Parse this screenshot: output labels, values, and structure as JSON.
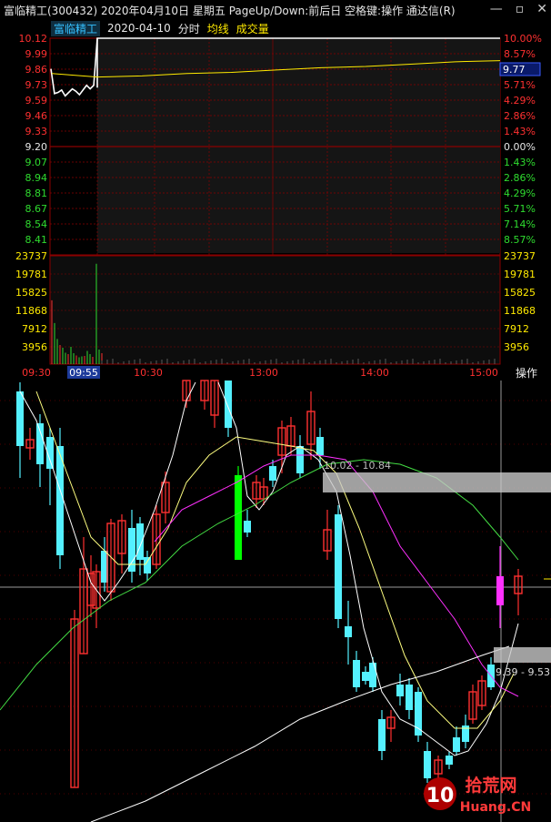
{
  "window": {
    "title": "富临精工(300432)  2020年04月10日  星期五  PageUp/Down:前后日  空格键:操作  通达信(R)",
    "buttons": [
      "—",
      "▫",
      "✕"
    ]
  },
  "subheader": {
    "stock_name": "富临精工",
    "date": "2020-04-10",
    "mode": "分时",
    "avg_label": "均线",
    "volume_label": "成交量"
  },
  "price_axis_left": [
    {
      "v": "10.12",
      "c": "#ff3030"
    },
    {
      "v": "9.99",
      "c": "#ff3030"
    },
    {
      "v": "9.86",
      "c": "#ff3030"
    },
    {
      "v": "9.73",
      "c": "#ff3030"
    },
    {
      "v": "9.59",
      "c": "#ff3030"
    },
    {
      "v": "9.46",
      "c": "#ff3030"
    },
    {
      "v": "9.33",
      "c": "#ff3030"
    },
    {
      "v": "9.20",
      "c": "#e6e6e6"
    },
    {
      "v": "9.07",
      "c": "#2fdc2f"
    },
    {
      "v": "8.94",
      "c": "#2fdc2f"
    },
    {
      "v": "8.81",
      "c": "#2fdc2f"
    },
    {
      "v": "8.67",
      "c": "#2fdc2f"
    },
    {
      "v": "8.54",
      "c": "#2fdc2f"
    },
    {
      "v": "8.41",
      "c": "#2fdc2f"
    }
  ],
  "pct_axis_right": [
    {
      "v": "10.00%",
      "c": "#ff3030"
    },
    {
      "v": "8.57%",
      "c": "#ff3030"
    },
    {
      "v": "7.14%",
      "c": "#ff3030"
    },
    {
      "v": "5.71%",
      "c": "#ff3030"
    },
    {
      "v": "4.29%",
      "c": "#ff3030"
    },
    {
      "v": "2.86%",
      "c": "#ff3030"
    },
    {
      "v": "1.43%",
      "c": "#ff3030"
    },
    {
      "v": "0.00%",
      "c": "#e6e6e6"
    },
    {
      "v": "1.43%",
      "c": "#2fdc2f"
    },
    {
      "v": "2.86%",
      "c": "#2fdc2f"
    },
    {
      "v": "4.29%",
      "c": "#2fdc2f"
    },
    {
      "v": "5.71%",
      "c": "#2fdc2f"
    },
    {
      "v": "7.14%",
      "c": "#2fdc2f"
    },
    {
      "v": "8.57%",
      "c": "#2fdc2f"
    }
  ],
  "current_price_tag": "9.77",
  "volume_axis": [
    "23737",
    "19781",
    "15825",
    "11868",
    "7912",
    "3956"
  ],
  "time_axis": [
    {
      "v": "09:30",
      "highlight": false
    },
    {
      "v": "09:55",
      "highlight": true
    },
    {
      "v": "10:30",
      "highlight": false
    },
    {
      "v": "13:00",
      "highlight": false
    },
    {
      "v": "14:00",
      "highlight": false
    },
    {
      "v": "15:00",
      "highlight": false
    }
  ],
  "ops_button": "操作",
  "annotations": {
    "upper_range": "10.02 - 10.84",
    "lower_range": "9.39 - 9.53"
  },
  "watermark": {
    "text": "拾荒网",
    "sub": "Huang.CN",
    "number": "10"
  },
  "colors": {
    "up": "#ff3030",
    "down": "#54f0ff",
    "flat_green": "#00ff00",
    "magenta": "#ff30ff",
    "grid": "#8b0000",
    "price_line": "#ffffff",
    "avg_line": "#ffea00"
  },
  "chart_data": {
    "type": "line",
    "intraday": {
      "prev_close": 9.2,
      "limit_up": 10.12,
      "x_sessions": [
        "09:30",
        "10:30",
        "13:00",
        "14:00",
        "15:00"
      ],
      "price_open_segment": [
        9.86,
        9.65,
        9.66,
        9.68,
        9.63,
        9.66,
        9.69,
        9.67,
        9.64,
        9.68,
        9.72,
        9.69,
        9.72,
        10.12
      ],
      "avg_line": [
        9.79,
        9.8,
        9.82,
        9.83,
        9.85,
        9.87,
        9.88,
        9.9,
        9.92,
        9.93
      ],
      "current": 9.77
    },
    "volume": [
      14000,
      9000,
      5500,
      4200,
      3600,
      2500,
      2200,
      3800,
      2400,
      1900,
      1500,
      1700,
      1800,
      2900,
      2200,
      1600,
      22000,
      3200,
      2400
    ]
  }
}
